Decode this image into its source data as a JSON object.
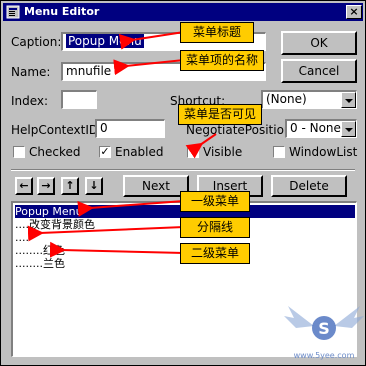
{
  "window": {
    "title": "Menu Editor",
    "close_label": "×"
  },
  "fields": {
    "caption": {
      "label": "Caption:",
      "value": "Popup Menu"
    },
    "name": {
      "label": "Name:",
      "value": "mnufile"
    },
    "index": {
      "label": "Index:",
      "value": ""
    },
    "helpcontext": {
      "label": "HelpContextID:",
      "value": "0"
    },
    "shortcut": {
      "label": "Shortcut:",
      "value": "(None)"
    },
    "negotiate": {
      "label": "NegotiatePosition:",
      "value": "0 - None"
    }
  },
  "checkboxes": [
    {
      "label": "Checked",
      "checked": false
    },
    {
      "label": "Enabled",
      "checked": true
    },
    {
      "label": "Visible",
      "checked": false
    },
    {
      "label": "WindowList",
      "checked": false
    }
  ],
  "buttons": {
    "ok": "OK",
    "cancel": "Cancel",
    "next": "Next",
    "insert": "Insert",
    "delete": "Delete"
  },
  "arrow_buttons": [
    "←",
    "→",
    "↑",
    "↓"
  ],
  "menu_items": [
    "Popup Menu",
    "....改变背景颜色",
    "....-",
    "........红色",
    "........兰色"
  ],
  "callouts": {
    "caption": "菜单标题",
    "name": "菜单项的名称",
    "visible": "菜单是否可见",
    "level1": "一级菜单",
    "separator": "分隔线",
    "level2": "二级菜单"
  },
  "colors": {
    "callout": "#ffcc00",
    "arrow": "#ff0000",
    "titlebar": "#000080",
    "dialog": "#c0c0c0"
  },
  "watermark": {
    "brand": "S",
    "caption": "www.5yee.com"
  }
}
